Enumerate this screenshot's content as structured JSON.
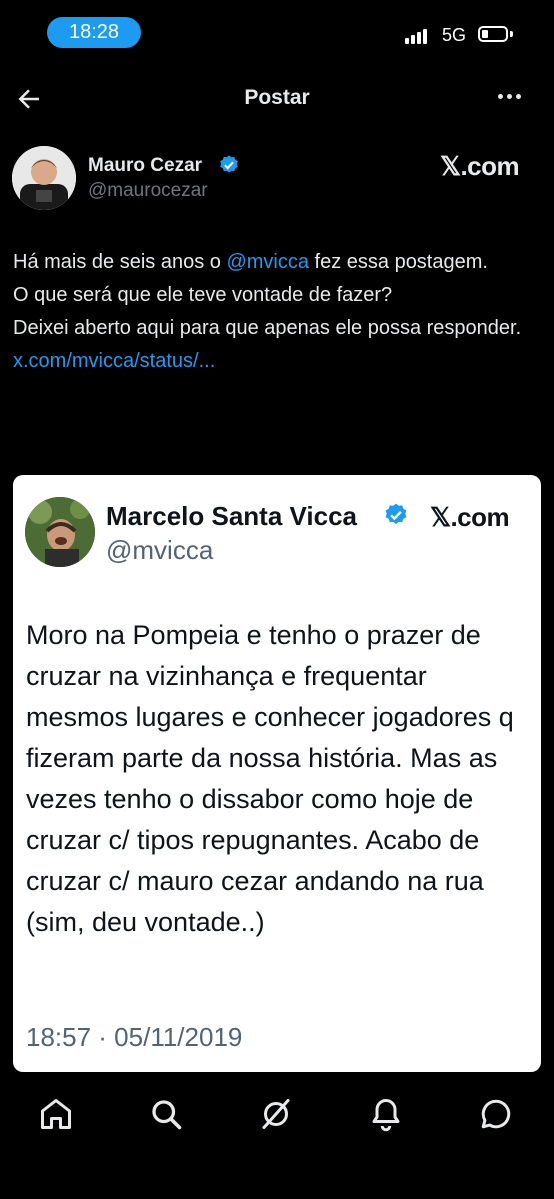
{
  "status_bar": {
    "time": "18:28",
    "network": "5G"
  },
  "header": {
    "title": "Postar"
  },
  "post": {
    "author_name": "Mauro Cezar",
    "author_handle": "@maurocezar",
    "source": "𝕏.com",
    "text_before_mention": "Há mais de seis anos o ",
    "mention": "@mvicca",
    "text_after_mention": " fez essa postagem.",
    "line2": "O que será que ele teve vontade de fazer?",
    "line3": "Deixei aberto aqui para que apenas ele possa responder.",
    "link": "x.com/mvicca/status/..."
  },
  "quoted_card": {
    "author_name": "Marcelo Santa Vicca",
    "author_handle": "@mvicca",
    "source": "𝕏.com",
    "text": "Moro na Pompeia e tenho o prazer de cruzar na vizinhança e frequentar mesmos lugares  e conhecer jogadores q fizeram parte da nossa história. Mas as vezes tenho o dissabor como hoje de cruzar c/ tipos repugnantes. Acabo de cruzar c/ mauro cezar andando na rua (sim, deu vontade..)",
    "timestamp": "18:57 · 05/11/2019"
  },
  "nav": {
    "items": [
      "home-icon",
      "search-icon",
      "grok-icon",
      "notifications-icon",
      "messages-icon"
    ]
  },
  "colors": {
    "accent": "#1d9bf0",
    "background": "#000000",
    "card": "#ffffff"
  }
}
